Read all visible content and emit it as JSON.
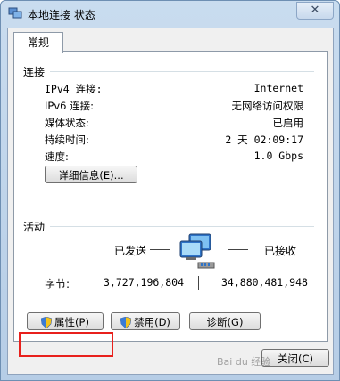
{
  "window": {
    "title": "本地连接 状态",
    "close_symbol": "✕"
  },
  "tab": {
    "label": "常规"
  },
  "connection": {
    "header": "连接",
    "rows": [
      {
        "label": "IPv4 连接:",
        "value": "Internet"
      },
      {
        "label": "IPv6 连接:",
        "value": "无网络访问权限"
      },
      {
        "label": "媒体状态:",
        "value": "已启用"
      },
      {
        "label": "持续时间:",
        "value": "2 天 02:09:17"
      },
      {
        "label": "速度:",
        "value": "1.0 Gbps"
      }
    ],
    "details_button": "详细信息(E)..."
  },
  "activity": {
    "header": "活动",
    "sent_label": "已发送",
    "received_label": "已接收",
    "bytes_label": "字节:",
    "bytes_sent": "3,727,196,804",
    "bytes_received": "34,880,481,948"
  },
  "buttons": {
    "properties": "属性(P)",
    "disable": "禁用(D)",
    "diagnose": "诊断(G)",
    "close": "关闭(C)"
  },
  "colors": {
    "highlight": "#e8201c",
    "accent": "#3a7bd5"
  },
  "icons": {
    "window": "network-icon",
    "shield": "uac-shield-icon",
    "activity": "network-computers-icon"
  },
  "watermark": "Bai du 经验"
}
